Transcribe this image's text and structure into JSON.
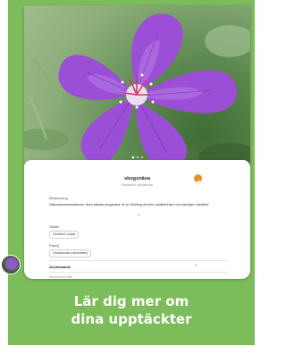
{
  "card": {
    "headline_line1": "Lär dig mer om",
    "headline_line2": "dina upptäckter",
    "colors": {
      "background": "#7cbc5a",
      "accent": "#f08a2b",
      "flower": "#9b4fd6"
    }
  },
  "photo": {
    "image_icon": "geranium-flower-photo"
  },
  "plant": {
    "common_name": "skogsnäva",
    "scientific_name": "Geranium sylvaticum"
  },
  "description": {
    "heading": "Beskrivning",
    "text": "Hälsorekommendationer, även kallade skogsnäva, är en Storblog att trivs i skälsbt träsrv och bandigen växtvärld"
  },
  "genus": {
    "label": "Släkte",
    "value": "Geranium (näva)"
  },
  "family": {
    "label": "Familj",
    "value": "Geraniaceae (näveväxter)"
  },
  "usage": {
    "label": "Användande"
  },
  "more": {
    "label": "Blommans fälti"
  }
}
